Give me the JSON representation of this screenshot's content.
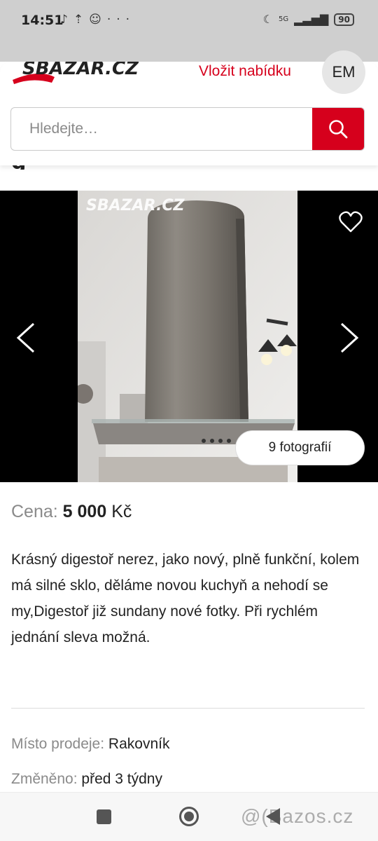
{
  "status_bar": {
    "time": "14:51",
    "notification_icons": [
      "tiktok-icon",
      "upload-icon",
      "snapchat-icon",
      "more-dots-icon"
    ],
    "network": "5G",
    "battery": "90"
  },
  "header": {
    "logo_text": "SBAZAR.CZ",
    "offer_link": "Vložit nabídku",
    "avatar_initials": "EM",
    "accent_color": "#d6001c"
  },
  "search": {
    "placeholder": "Hledejte…",
    "value": ""
  },
  "title_peek": "g",
  "gallery": {
    "photo_watermark": "SBAZAR.CZ",
    "photo_count_label": "9 fotografií"
  },
  "listing": {
    "price_label": "Cena:",
    "price_value": "5 000",
    "price_currency": "Kč",
    "description": "Krásný digestoř nerez, jako nový, plně funkční, kolem má silné sklo, děláme novou kuchyň a nehodí se my,Digestoř již sundany nové fotky. Při rychlém jednání sleva možná.",
    "location_label": "Místo prodeje:",
    "location_value": "Rakovník",
    "changed_label": "Změněno:",
    "changed_value": "před 3 týdny"
  },
  "navbar": {
    "watermark": "@(Bazos.cz"
  }
}
